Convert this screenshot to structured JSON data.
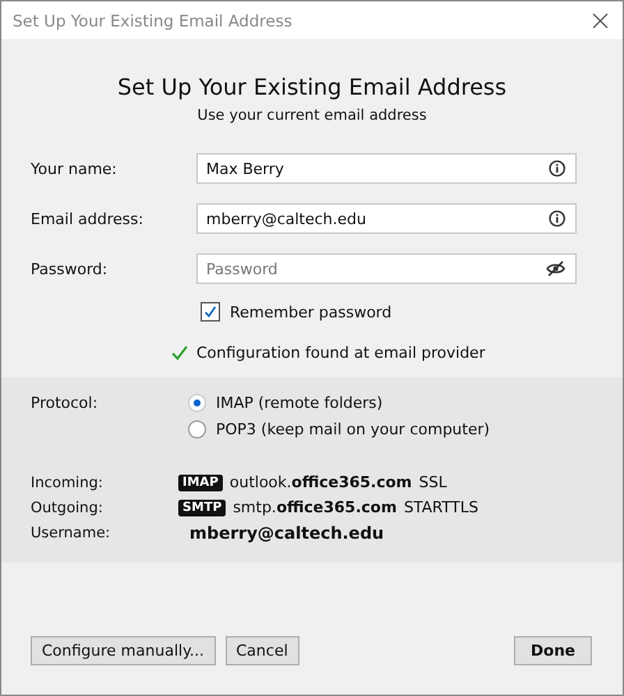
{
  "window": {
    "title": "Set Up Your Existing Email Address"
  },
  "heading": "Set Up Your Existing Email Address",
  "subheading": "Use your current email address",
  "fields": [
    {
      "label": "Your name:",
      "value": "Max Berry",
      "kind": "info"
    },
    {
      "label": "Email address:",
      "value": "mberry@caltech.edu",
      "kind": "info"
    },
    {
      "label": "Password:",
      "placeholder": "Password",
      "kind": "password"
    }
  ],
  "remember": {
    "label": "Remember password",
    "checked": true
  },
  "status": "Configuration found at email provider",
  "protocol": {
    "label": "Protocol:",
    "options": [
      {
        "label": "IMAP (remote folders)",
        "selected": true
      },
      {
        "label": "POP3 (keep mail on your computer)",
        "selected": false
      }
    ]
  },
  "servers": [
    {
      "label": "Incoming:",
      "badge": "IMAP",
      "host": "outlook.**office365.com**",
      "security": "SSL"
    },
    {
      "label": "Outgoing:",
      "badge": "SMTP",
      "host": "smtp.**office365.com**",
      "security": "STARTTLS"
    }
  ],
  "username": {
    "label": "Username:",
    "value": "mberry@caltech.edu"
  },
  "buttons": [
    {
      "label": "Configure manually...",
      "kind": "left"
    },
    {
      "label": "Cancel",
      "kind": "left"
    },
    {
      "label": "Done",
      "kind": "primary"
    }
  ]
}
